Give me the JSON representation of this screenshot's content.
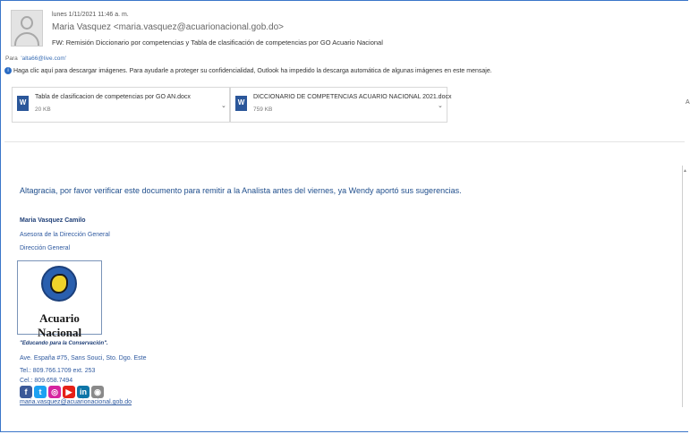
{
  "header": {
    "date": "lunes 1/11/2021 11:46 a. m.",
    "sender": "Maria Vasquez <maria.vasquez@acuarionacional.gob.do>",
    "subject": "FW: Remisión Diccionario por competencias y Tabla de clasificación de competencias por GO Acuario Nacional",
    "to_label": "Para",
    "to_value": "'alta66@live.com'"
  },
  "info_bar": {
    "text": "Haga clic aquí para descargar imágenes. Para ayudarle a proteger su confidencialidad, Outlook ha impedido la descarga automática de algunas imágenes en este mensaje."
  },
  "attachments": [
    {
      "name": "Tabla de clasificacion de competencias por GO AN.docx",
      "size": "20 KB"
    },
    {
      "name": "DICCIONARIO DE COMPETENCIAS ACUARIO NACIONAL 2021.docx",
      "size": "759 KB"
    }
  ],
  "edge_label": "A",
  "body": {
    "message": "Altagracia, por favor verificar este documento para remitir a la Analista antes del viernes, ya Wendy aportó sus sugerencias."
  },
  "signature": {
    "name": "Maria Vasquez Camilo",
    "title": "Asesora de la Dirección General",
    "department": "Dirección General",
    "logo_text": "Acuario Nacional",
    "slogan": "\"Educando para la Conservación\".",
    "address": "Ave. España #75, Sans Souci, Sto. Dgo. Este",
    "phone": "Tel.: 809.766.1709 ext. 253",
    "cell": "Cel.: 809.658.7494",
    "email": "maria.vasquez@acuarionacional.gob.do"
  },
  "social": [
    {
      "icon": "facebook-icon",
      "glyph": "f",
      "color": "#3b5998"
    },
    {
      "icon": "twitter-icon",
      "glyph": "t",
      "color": "#1da1f2"
    },
    {
      "icon": "instagram-icon",
      "glyph": "◎",
      "color": "#d6249f"
    },
    {
      "icon": "youtube-icon",
      "glyph": "▶",
      "color": "#e62117"
    },
    {
      "icon": "linkedin-icon",
      "glyph": "in",
      "color": "#0e76a8"
    },
    {
      "icon": "website-icon",
      "glyph": "◉",
      "color": "#8a8a8a"
    }
  ]
}
